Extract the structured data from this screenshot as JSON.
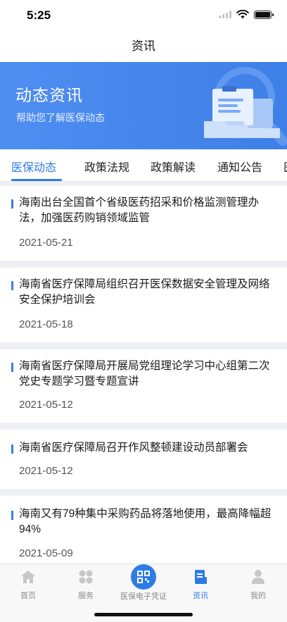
{
  "status_bar": {
    "time": "5:25"
  },
  "nav": {
    "title": "资讯"
  },
  "banner": {
    "title": "动态资讯",
    "subtitle": "帮助您了解医保动态"
  },
  "tabs": [
    {
      "label": "医保动态",
      "active": true
    },
    {
      "label": "政策法规",
      "active": false
    },
    {
      "label": "政策解读",
      "active": false
    },
    {
      "label": "通知公告",
      "active": false
    },
    {
      "label": "医",
      "active": false
    }
  ],
  "news": [
    {
      "title": "海南出台全国首个省级医药招采和价格监测管理办法，加强医药购销领域监管",
      "date": "2021-05-21"
    },
    {
      "title": "海南省医疗保障局组织召开医保数据安全管理及网络安全保护培训会",
      "date": "2021-05-18"
    },
    {
      "title": "海南省医疗保障局开展局党组理论学习中心组第二次党史专题学习暨专题宣讲",
      "date": "2021-05-12"
    },
    {
      "title": "海南省医疗保障局召开作风整顿建设动员部署会",
      "date": "2021-05-12"
    },
    {
      "title": "海南又有79种集中采购药品将落地使用，最高降幅超94%",
      "date": "2021-05-09"
    }
  ],
  "tabbar": [
    {
      "label": "首页",
      "icon": "home-icon",
      "active": false
    },
    {
      "label": "服务",
      "icon": "grid-icon",
      "active": false
    },
    {
      "label": "医保电子凭证",
      "icon": "qr-code-icon",
      "active": false
    },
    {
      "label": "资讯",
      "icon": "news-icon",
      "active": true
    },
    {
      "label": "我的",
      "icon": "person-icon",
      "active": false
    }
  ],
  "colors": {
    "accent": "#2e7be6",
    "banner": "#4a8af0"
  }
}
